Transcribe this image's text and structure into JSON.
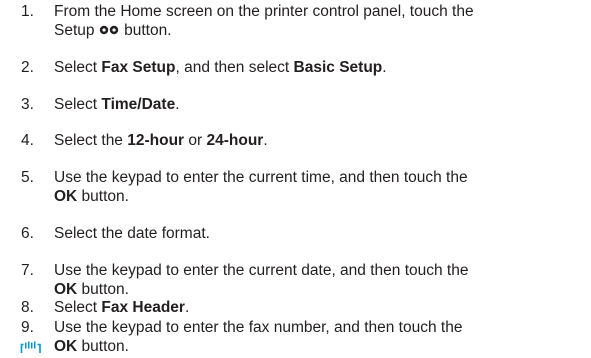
{
  "steps": [
    {
      "num": "1.",
      "line1": "From the Home screen on the printer control panel, touch the",
      "line2_pre": "Setup ",
      "line2_post": " button.",
      "icon": "setup-gear-icon"
    },
    {
      "num": "2.",
      "t1": "Select ",
      "b1": "Fax Setup",
      "t2": ", and then select ",
      "b2": "Basic Setup",
      "t3": "."
    },
    {
      "num": "3.",
      "t1": "Select ",
      "b1": "Time/Date",
      "t2": "."
    },
    {
      "num": "4.",
      "t1": "Select the ",
      "b1": "12-hour",
      "t2": " or ",
      "b2": "24-hour",
      "t3": "."
    },
    {
      "num": "5.",
      "line1": "Use the keypad to enter the current time, and then touch the",
      "b1": "OK",
      "t2": " button."
    },
    {
      "num": "6.",
      "line1": "Select the date format."
    },
    {
      "num": "7.",
      "line1": "Use the keypad to enter the current date, and then touch the",
      "b1": "OK",
      "t2": " button."
    },
    {
      "num": "8.",
      "t1": "Select ",
      "b1": "Fax Header",
      "t2": "."
    },
    {
      "num": "9.",
      "line1": "Use the keypad to enter the fax number, and then touch the",
      "b1": "OK",
      "t2": " button.",
      "icon": "fax-icon"
    }
  ],
  "colors": {
    "text": "#231f20",
    "accent": "#0096d6"
  }
}
